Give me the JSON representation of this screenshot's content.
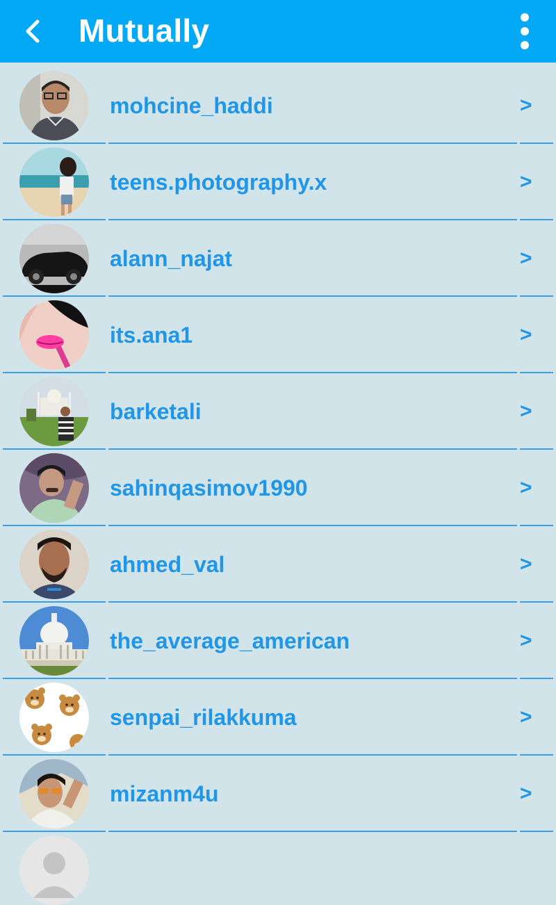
{
  "app_bar": {
    "title": "Mutually",
    "background": "#03a9f4",
    "back_icon": "chevron-left-icon",
    "menu_icon": "more-vertical-icon"
  },
  "list": {
    "chevron": ">",
    "accent": "#2196e6",
    "items": [
      {
        "username": "mohcine_haddi"
      },
      {
        "username": "teens.photography.x"
      },
      {
        "username": "alann_najat"
      },
      {
        "username": "its.ana1"
      },
      {
        "username": "barketali"
      },
      {
        "username": "sahinqasimov1990"
      },
      {
        "username": "ahmed_val"
      },
      {
        "username": "the_average_american"
      },
      {
        "username": "senpai_rilakkuma"
      },
      {
        "username": "mizanm4u"
      }
    ]
  }
}
